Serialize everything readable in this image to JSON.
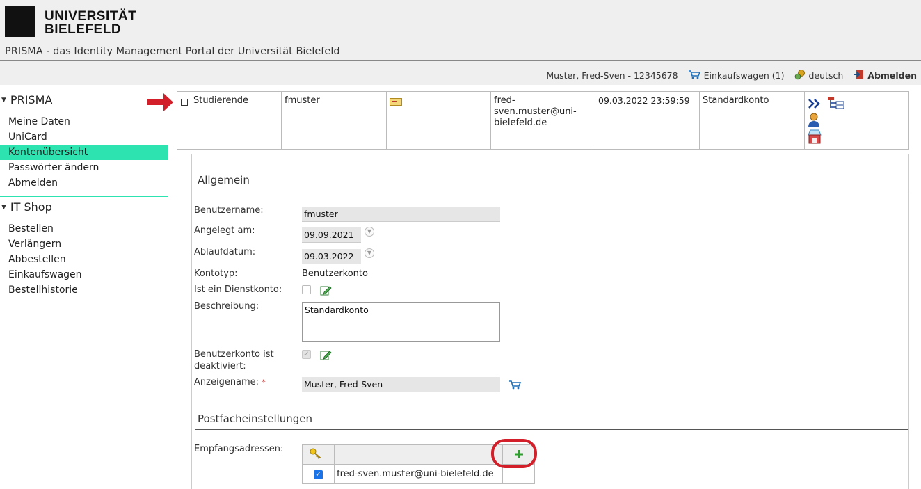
{
  "header": {
    "logo_line1": "UNIVERSITÄT",
    "logo_line2": "BIELEFELD",
    "portal_title": "PRISMA - das Identity Management Portal der Universität Bielefeld"
  },
  "userbar": {
    "user": "Muster, Fred-Sven - 12345678",
    "cart": "Einkaufswagen (1)",
    "language": "deutsch",
    "logout": "Abmelden"
  },
  "sidebar": {
    "prisma_title": "PRISMA",
    "prisma_items": [
      {
        "label": "Meine Daten"
      },
      {
        "label": "UniCard"
      },
      {
        "label": "Kontenübersicht"
      },
      {
        "label": "Passwörter ändern"
      },
      {
        "label": "Abmelden"
      }
    ],
    "itshop_title": "IT Shop",
    "itshop_items": [
      {
        "label": "Bestellen"
      },
      {
        "label": "Verlängern"
      },
      {
        "label": "Abbestellen"
      },
      {
        "label": "Einkaufswagen"
      },
      {
        "label": "Bestellhistorie"
      }
    ]
  },
  "account_row": {
    "type": "Studierende",
    "username": "fmuster",
    "email_line1": "fred-sven.muster@uni-",
    "email_line2": "bielefeld.de",
    "expiry": "09.03.2022 23:59:59",
    "description": "Standardkonto"
  },
  "general": {
    "title": "Allgemein",
    "username_label": "Benutzername:",
    "username_value": "fmuster",
    "created_label": "Angelegt am:",
    "created_value": "09.09.2021",
    "expiry_label": "Ablaufdatum:",
    "expiry_value": "09.03.2022",
    "type_label": "Kontotyp:",
    "type_value": "Benutzerkonto",
    "service_label": "Ist ein Dienstkonto:",
    "desc_label": "Beschreibung:",
    "desc_value": "Standardkonto",
    "disabled_label_line1": "Benutzerkonto ist",
    "disabled_label_line2": "deaktiviert:",
    "display_label": "Anzeigename:",
    "display_required": "*",
    "display_value": "Muster, Fred-Sven"
  },
  "mailbox": {
    "title": "Postfacheinstellungen",
    "recv_label": "Empfangsadressen:",
    "addresses": [
      {
        "address": "fred-sven.muster@uni-bielefeld.de",
        "checked": true
      }
    ]
  },
  "colors": {
    "accent": "#2de4b0",
    "highlight_red": "#d21f2a"
  }
}
